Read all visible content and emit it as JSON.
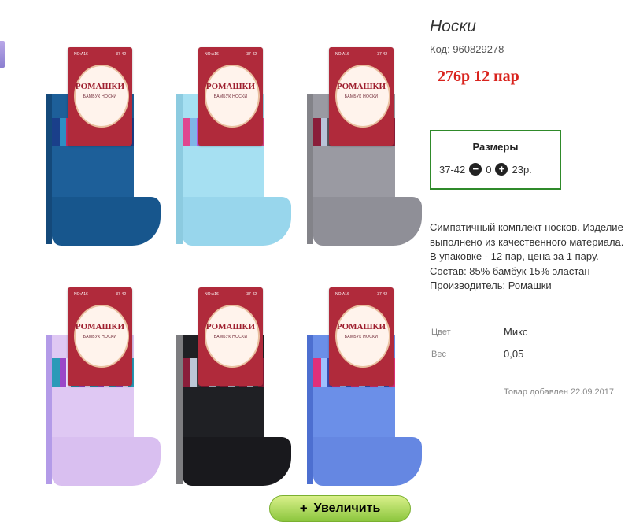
{
  "product": {
    "title": "Носки",
    "code_label": "Код: 960829278",
    "price": "276р 12 пар"
  },
  "sizes": {
    "title": "Размеры",
    "size": "37-42",
    "quantity": "0",
    "unit_price": "23р."
  },
  "description": "Симпатичный комплект носков. Изделие выполнено из качественного материала. В упаковке - 12 пар, цена за 1 пару. Состав: 85% бамбук 15% эластан Производитель: Ромашки",
  "attributes": [
    {
      "label": "Цвет",
      "value": "Микс"
    },
    {
      "label": "Вес",
      "value": "0,05"
    }
  ],
  "added_date": "Товар добавлен 22.09.2017",
  "gallery": {
    "zoom_label": "Увеличить",
    "package_brand": "РОМАШКИ",
    "package_sub": "БАМБУК НОСКИ",
    "package_code": "NO:A16",
    "package_size": "37-42",
    "sock_colors": [
      "#1d5f99",
      "#a6e0f2",
      "#9a9aa2",
      "#dfc8f3",
      "#1f2024",
      "#6b8fe8"
    ]
  }
}
